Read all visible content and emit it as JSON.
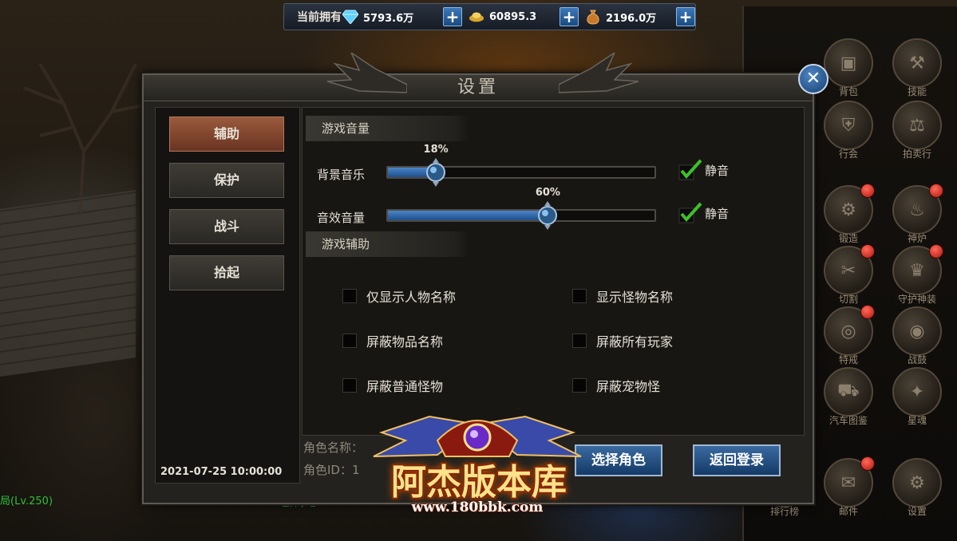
{
  "currency": {
    "label": "当前拥有",
    "items": [
      {
        "icon": "diamond-icon",
        "value": "5793.6万"
      },
      {
        "icon": "gold-ingot-icon",
        "value": "60895.3"
      },
      {
        "icon": "coin-bag-icon",
        "value": "2196.0万"
      }
    ],
    "plus": "+"
  },
  "dialog": {
    "title": "设置",
    "close": "✕",
    "tabs": [
      {
        "label": "辅助",
        "active": true
      },
      {
        "label": "保护",
        "active": false
      },
      {
        "label": "战斗",
        "active": false
      },
      {
        "label": "拾起",
        "active": false
      }
    ],
    "datetime": "2021-07-25  10:00:00",
    "volume_section": "游戏音量",
    "bgm": {
      "label": "背景音乐",
      "percent_text": "18%",
      "value": 0.18,
      "mute_label": "静音",
      "muted": true
    },
    "sfx": {
      "label": "音效音量",
      "percent_text": "60%",
      "value": 0.6,
      "mute_label": "静音",
      "muted": true
    },
    "assist_section": "游戏辅助",
    "options": [
      {
        "label": "仅显示人物名称",
        "checked": false
      },
      {
        "label": "显示怪物名称",
        "checked": false
      },
      {
        "label": "屏蔽物品名称",
        "checked": false
      },
      {
        "label": "屏蔽所有玩家",
        "checked": false
      },
      {
        "label": "屏蔽普通怪物",
        "checked": false
      },
      {
        "label": "屏蔽宠物怪",
        "checked": false
      }
    ],
    "role_name_label": "角色名称：",
    "role_id_label": "角色ID：1",
    "select_role_button": "选择角色",
    "return_login_button": "返回登录"
  },
  "side_menu": [
    {
      "label": "背包",
      "icon": "backpack-icon",
      "badge": false
    },
    {
      "label": "技能",
      "icon": "skill-icon",
      "badge": false
    },
    {
      "label": "行会",
      "icon": "guild-icon",
      "badge": false
    },
    {
      "label": "拍卖行",
      "icon": "auction-icon",
      "badge": false
    },
    {
      "label": "锻造",
      "icon": "forge-icon",
      "badge": true
    },
    {
      "label": "神炉",
      "icon": "furnace-icon",
      "badge": true
    },
    {
      "label": "切割",
      "icon": "cut-icon",
      "badge": true
    },
    {
      "label": "守护神装",
      "icon": "guardian-icon",
      "badge": true
    },
    {
      "label": "特戒",
      "icon": "ring-icon",
      "badge": true
    },
    {
      "label": "战鼓",
      "icon": "drum-icon",
      "badge": false
    },
    {
      "label": "汽车图鉴",
      "icon": "car-icon",
      "badge": false
    },
    {
      "label": "星魂",
      "icon": "star-soul-icon",
      "badge": false
    },
    {
      "label": "排行榜",
      "icon": "ranking-icon",
      "badge": false
    },
    {
      "label": "邮件",
      "icon": "mail-icon",
      "badge": true
    },
    {
      "label": "设置",
      "icon": "settings-icon",
      "badge": false
    }
  ],
  "world": {
    "player_tag": "局(Lv.250)",
    "npc_tag": "已开小塔"
  },
  "watermark": {
    "title": "阿杰版本库",
    "url": "www.180bbk.com"
  },
  "colors": {
    "accent_blue": "#2e6aa8",
    "active_tab": "#8a4a30",
    "check_green": "#3ec02a",
    "badge_red": "#c8201a"
  }
}
